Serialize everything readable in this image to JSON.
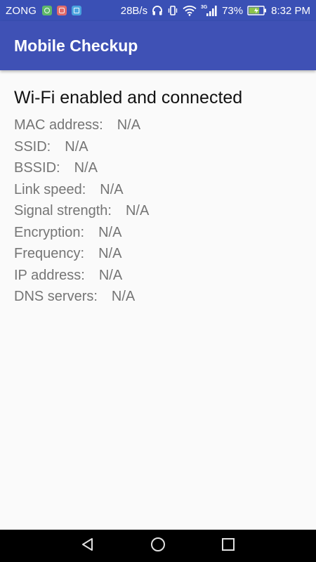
{
  "status_bar": {
    "carrier": "ZONG",
    "notification_icons": [
      {
        "name": "green-app-icon",
        "color": "#5fb86a"
      },
      {
        "name": "red-app-icon",
        "color": "#e06b6b"
      },
      {
        "name": "blue-app-icon",
        "color": "#4aa3df"
      }
    ],
    "network_speed": "28B/s",
    "network_type": "3G",
    "battery_percent": "73%",
    "battery_level": 0.73,
    "time": "8:32 PM",
    "icons": [
      "headphones-icon",
      "vibrate-icon",
      "wifi-icon",
      "signal-icon",
      "battery-charging-icon"
    ]
  },
  "app_bar": {
    "title": "Mobile Checkup",
    "color": "#3f51b5"
  },
  "wifi_info": {
    "status": "Wi-Fi enabled and connected",
    "rows": [
      {
        "label": "MAC address:",
        "value": "N/A"
      },
      {
        "label": "SSID:",
        "value": "N/A"
      },
      {
        "label": "BSSID:",
        "value": "N/A"
      },
      {
        "label": "Link speed:",
        "value": "N/A"
      },
      {
        "label": "Signal strength:",
        "value": "N/A"
      },
      {
        "label": "Encryption:",
        "value": "N/A"
      },
      {
        "label": "Frequency:",
        "value": "N/A"
      },
      {
        "label": "IP address:",
        "value": "N/A"
      },
      {
        "label": "DNS servers:",
        "value": "N/A"
      }
    ]
  },
  "nav_bar": {
    "buttons": [
      "back-icon",
      "home-icon",
      "recent-apps-icon"
    ]
  }
}
